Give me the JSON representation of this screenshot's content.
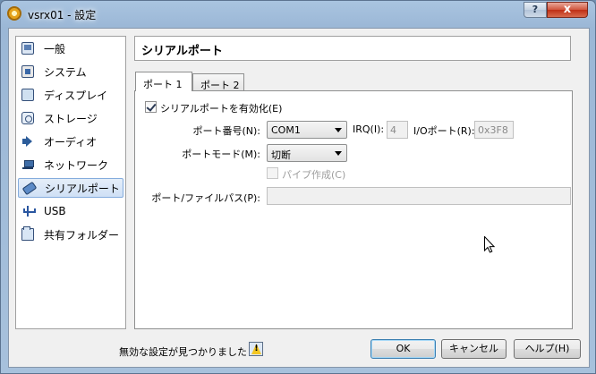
{
  "window": {
    "title": "vsrx01 - 設定",
    "help_glyph": "?",
    "close_glyph": "x"
  },
  "sidebar": {
    "items": [
      {
        "label": "一般",
        "icon": "general-icon"
      },
      {
        "label": "システム",
        "icon": "system-icon"
      },
      {
        "label": "ディスプレイ",
        "icon": "display-icon"
      },
      {
        "label": "ストレージ",
        "icon": "storage-icon"
      },
      {
        "label": "オーディオ",
        "icon": "audio-icon"
      },
      {
        "label": "ネットワーク",
        "icon": "network-icon"
      },
      {
        "label": "シリアルポート",
        "icon": "serial-port-icon",
        "selected": true
      },
      {
        "label": "USB",
        "icon": "usb-icon"
      },
      {
        "label": "共有フォルダー",
        "icon": "shared-folder-icon"
      }
    ]
  },
  "page": {
    "title": "シリアルポート",
    "tabs": [
      {
        "label": "ポート 1",
        "active": true
      },
      {
        "label": "ポート 2",
        "active": false
      }
    ],
    "enable_checkbox": {
      "label": "シリアルポートを有効化(E)",
      "checked": true
    },
    "port_number": {
      "label": "ポート番号(N):",
      "value": "COM1"
    },
    "irq": {
      "label": "IRQ(I):",
      "value": "4"
    },
    "io_port": {
      "label": "I/Oポート(R):",
      "value": "0x3F8"
    },
    "port_mode": {
      "label": "ポートモード(M):",
      "value": "切断"
    },
    "create_pipe": {
      "label": "パイプ作成(C)",
      "checked": false,
      "disabled": true
    },
    "port_path": {
      "label": "ポート/ファイルパス(P):",
      "value": ""
    }
  },
  "footer": {
    "status": "無効な設定が見つかりました",
    "status_icon": "warning-icon",
    "ok": "OK",
    "cancel": "キャンセル",
    "help": "ヘルプ(H)"
  }
}
